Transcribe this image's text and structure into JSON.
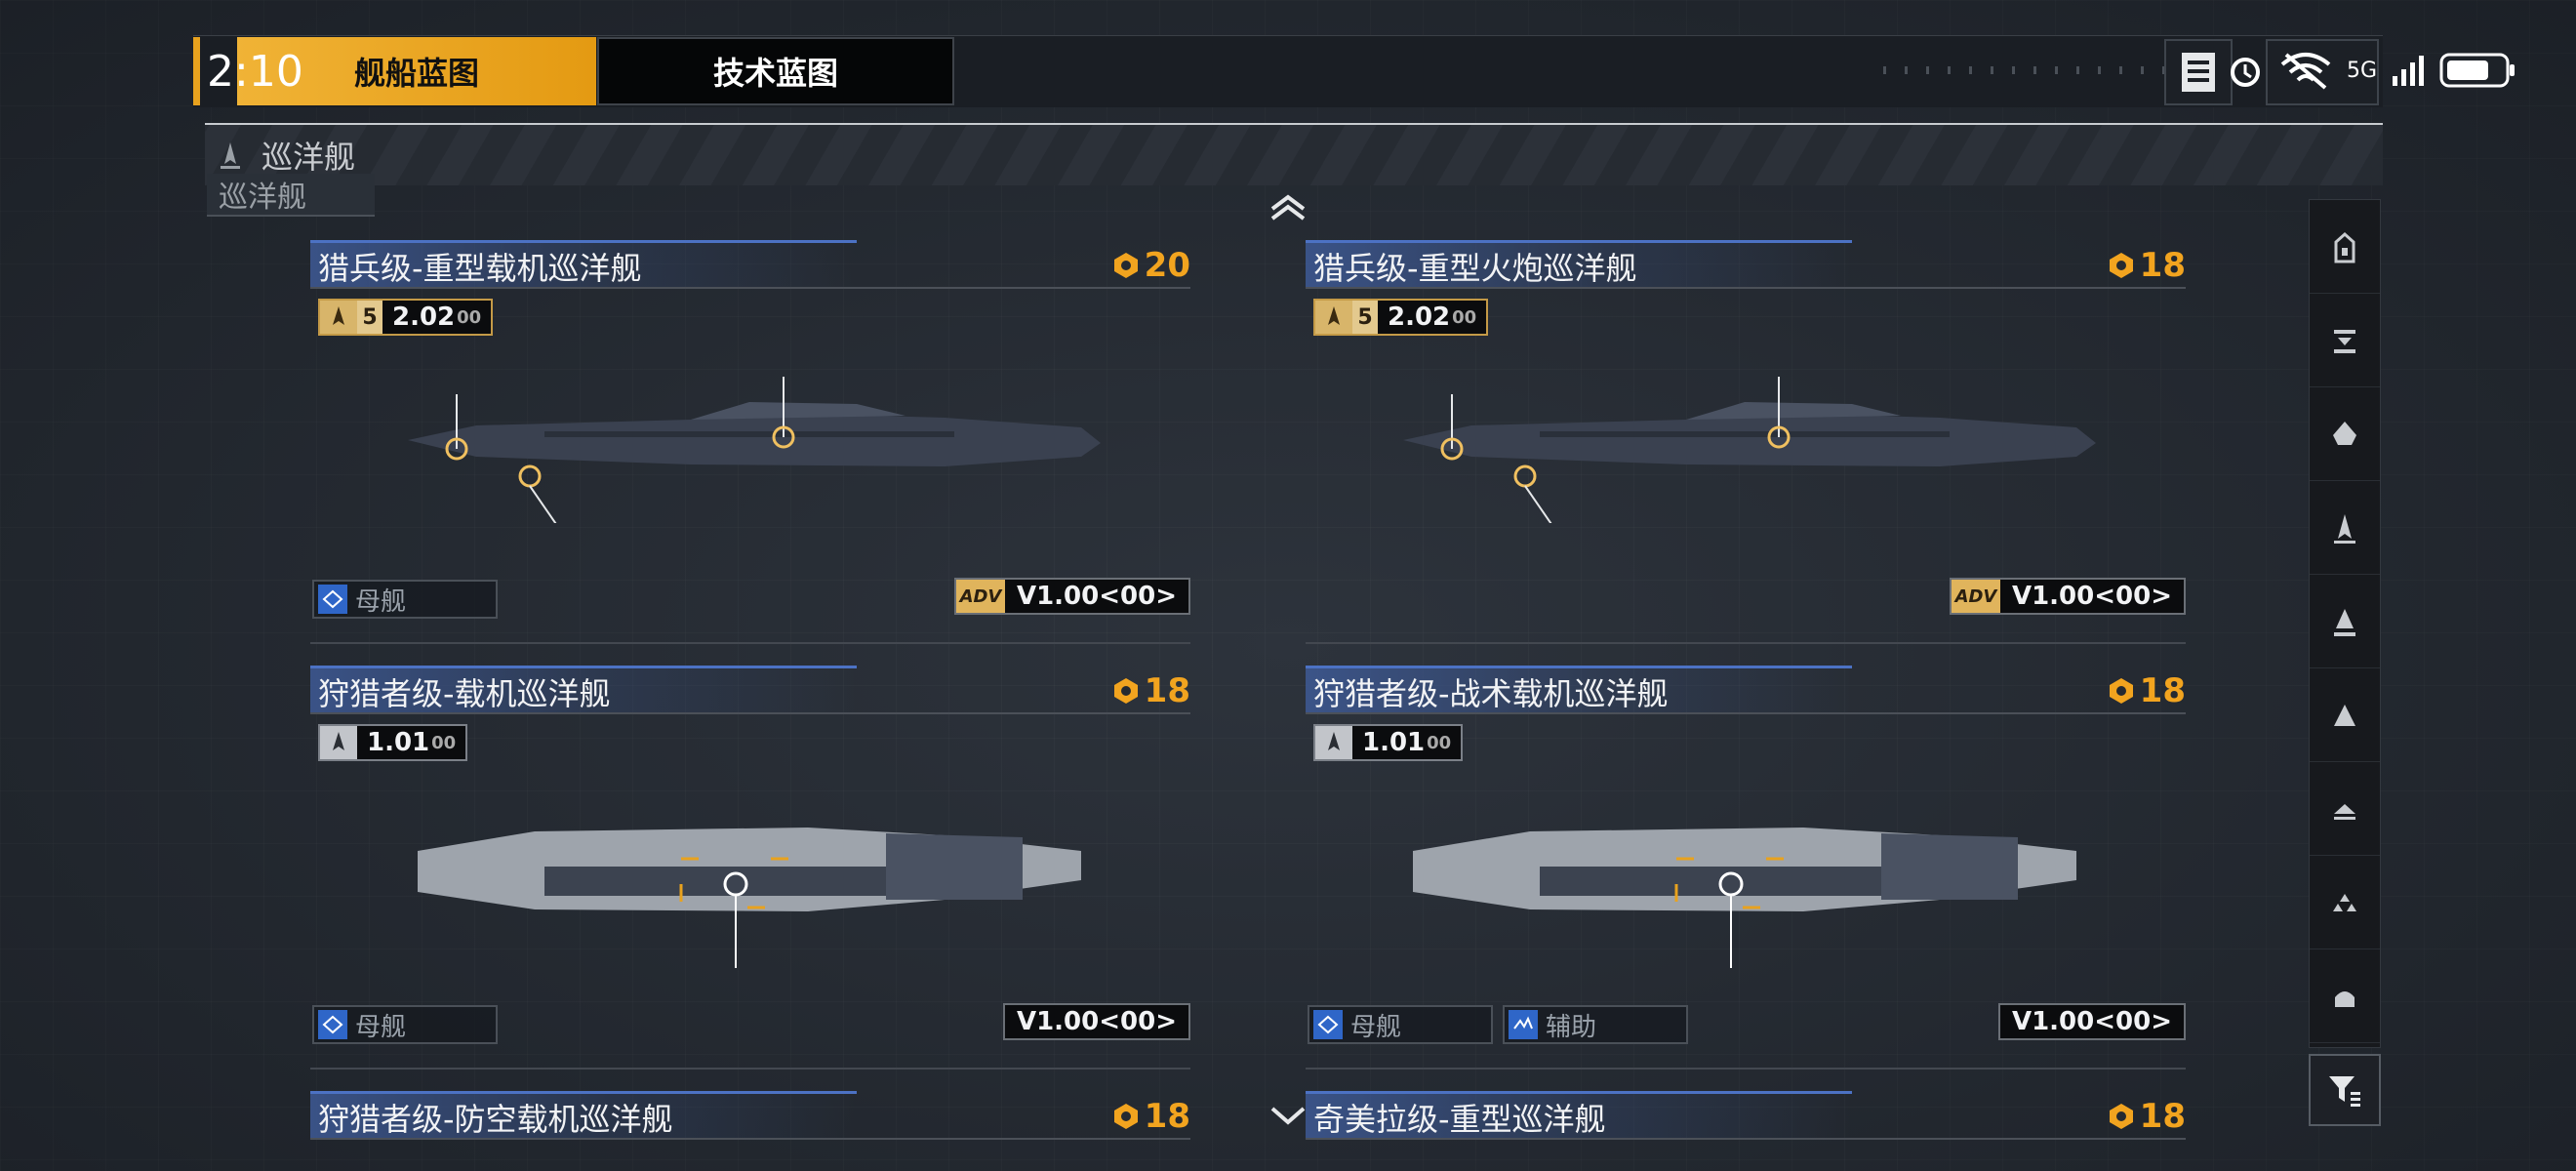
{
  "status_bar": {
    "time": "2:10",
    "network": "5G"
  },
  "tabs": [
    {
      "label": "舰船蓝图",
      "active": true
    },
    {
      "label": "技术蓝图",
      "active": false
    }
  ],
  "category": {
    "label": "巡洋舰",
    "ghost_label": "巡洋舰"
  },
  "colors": {
    "accent": "#e8a21e",
    "cost": "#f2a41f",
    "title_bar": "#3e5a96",
    "role_icon": "#2f66c8"
  },
  "ships": [
    {
      "name": "猎兵级-重型载机巡洋舰",
      "cost": "20",
      "badge": {
        "style": "gold",
        "tier": "5",
        "version": "2.02",
        "suffix": "00"
      },
      "roles": [
        "母舰"
      ],
      "adv": true,
      "version_tag": "V1.00<00>"
    },
    {
      "name": "猎兵级-重型火炮巡洋舰",
      "cost": "18",
      "badge": {
        "style": "gold",
        "tier": "5",
        "version": "2.02",
        "suffix": "00"
      },
      "roles": [],
      "adv": true,
      "version_tag": "V1.00<00>"
    },
    {
      "name": "狩猎者级-载机巡洋舰",
      "cost": "18",
      "badge": {
        "style": "gray",
        "tier": "",
        "version": "1.01",
        "suffix": "00"
      },
      "roles": [
        "母舰"
      ],
      "adv": false,
      "version_tag": "V1.00<00>"
    },
    {
      "name": "狩猎者级-战术载机巡洋舰",
      "cost": "18",
      "badge": {
        "style": "gray",
        "tier": "",
        "version": "1.01",
        "suffix": "00"
      },
      "roles": [
        "母舰",
        "辅助"
      ],
      "adv": false,
      "version_tag": "V1.00<00>"
    },
    {
      "name": "狩猎者级-防空载机巡洋舰",
      "cost": "18"
    },
    {
      "name": "奇美拉级-重型巡洋舰",
      "cost": "18"
    }
  ],
  "filter_rail": {
    "icons": [
      "frigate-icon",
      "destroyer-icon",
      "cruiser-icon",
      "battlecruiser-icon",
      "carrier-icon",
      "battleship-icon",
      "auxiliary-icon",
      "aircraft-icon",
      "corvette-icon"
    ],
    "filter_icon": "filter-icon"
  },
  "adv_label": "ADV"
}
